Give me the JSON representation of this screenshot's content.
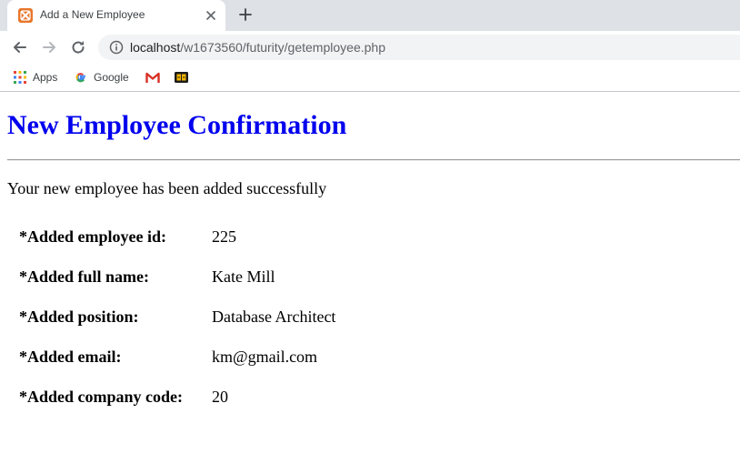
{
  "browser": {
    "tab": {
      "title": "Add a New Employee"
    },
    "address": {
      "host": "localhost",
      "path": "/w1673560/futurity/getemployee.php"
    },
    "bookmarks": [
      {
        "label": "Apps",
        "icon": "apps-grid-icon"
      },
      {
        "label": "Google",
        "icon": "google-g-icon"
      },
      {
        "label": "",
        "icon": "gmail-icon"
      },
      {
        "label": "",
        "icon": "behance-icon"
      }
    ]
  },
  "page": {
    "title": "New Employee Confirmation",
    "message": "Your new employee has been added successfully",
    "details": [
      {
        "label": "*Added employee id:",
        "value": "225"
      },
      {
        "label": "*Added full name:",
        "value": "Kate Mill"
      },
      {
        "label": "*Added position:",
        "value": "Database Architect"
      },
      {
        "label": "*Added email:",
        "value": "km@gmail.com"
      },
      {
        "label": "*Added company code:",
        "value": "20"
      }
    ]
  },
  "colors": {
    "title": "#0000ee",
    "favicon": "#e8762b"
  }
}
